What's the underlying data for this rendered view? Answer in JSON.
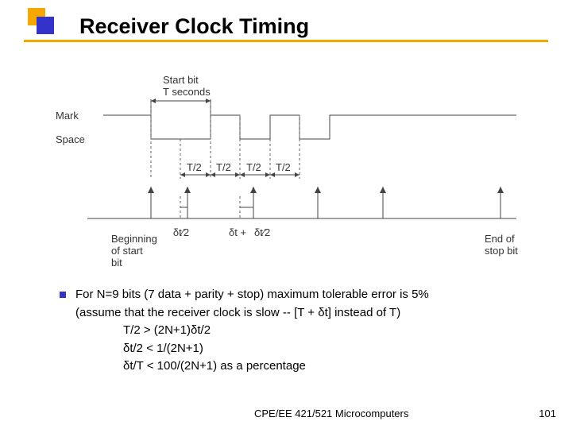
{
  "title": "Receiver Clock Timing",
  "diagram": {
    "startbit_label1": "Start bit",
    "startbit_label2": "T seconds",
    "mark": "Mark",
    "space": "Space",
    "t_half_1": "T/2",
    "t_half_2": "T/2",
    "t_half_3": "T/2",
    "t_half_4": "T/2",
    "dt_over_2": "δt⁄2",
    "dt_plus": "δt + ",
    "begin1": "Beginning",
    "begin2": "of start",
    "begin3": "bit",
    "end1": "End of",
    "end2": "stop bit"
  },
  "bullet": {
    "main1": "For N=9 bits (7 data + parity + stop) maximum tolerable error is 5%",
    "main2": "(assume that the receiver clock is slow -- [T + δt] instead of T)",
    "line1": "T/2 > (2N+1)δt/2",
    "line2": "δt/2 < 1/(2N+1)",
    "line3": "δt/T < 100/(2N+1) as a percentage"
  },
  "footer": {
    "course": "CPE/EE 421/521 Microcomputers",
    "page": "101"
  }
}
